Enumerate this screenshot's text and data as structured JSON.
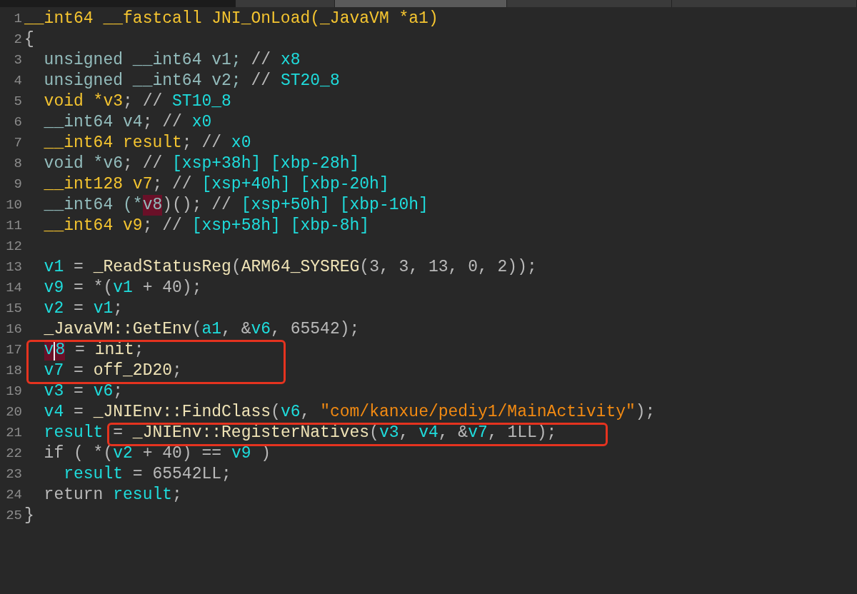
{
  "tabs": [
    {
      "selected": false
    },
    {
      "selected": true
    },
    {
      "selected": false
    },
    {
      "selected": false
    }
  ],
  "lines": [
    {
      "number": "1",
      "tokens": [
        {
          "t": "__int64 __fastcall JNI_OnLoad(_JavaVM *a1)",
          "kind": "decl"
        }
      ]
    },
    {
      "number": "2",
      "tokens": [
        {
          "t": "{",
          "kind": "op"
        }
      ]
    },
    {
      "number": "3",
      "tokens": [
        {
          "t": "  unsigned __int64 v1; ",
          "kind": "type"
        },
        {
          "t": "// ",
          "kind": "op"
        },
        {
          "t": "x8",
          "kind": "var"
        }
      ]
    },
    {
      "number": "4",
      "tokens": [
        {
          "t": "  unsigned __int64 v2; ",
          "kind": "type"
        },
        {
          "t": "// ",
          "kind": "op"
        },
        {
          "t": "ST20_8",
          "kind": "var"
        }
      ]
    },
    {
      "number": "5",
      "tokens": [
        {
          "t": "  void *v3",
          "kind": "decl"
        },
        {
          "t": "; // ",
          "kind": "op"
        },
        {
          "t": "ST10_8",
          "kind": "var"
        }
      ]
    },
    {
      "number": "6",
      "tokens": [
        {
          "t": "  __int64 v4",
          "kind": "type"
        },
        {
          "t": "; // ",
          "kind": "op"
        },
        {
          "t": "x0",
          "kind": "var"
        }
      ]
    },
    {
      "number": "7",
      "tokens": [
        {
          "t": "  __int64 result",
          "kind": "decl"
        },
        {
          "t": "; // ",
          "kind": "op"
        },
        {
          "t": "x0",
          "kind": "var"
        }
      ]
    },
    {
      "number": "8",
      "tokens": [
        {
          "t": "  void *v6",
          "kind": "type"
        },
        {
          "t": "; // ",
          "kind": "op"
        },
        {
          "t": "[xsp+38h] [xbp-28h]",
          "kind": "var"
        }
      ]
    },
    {
      "number": "9",
      "tokens": [
        {
          "t": "  __int128 v7",
          "kind": "decl"
        },
        {
          "t": "; // ",
          "kind": "op"
        },
        {
          "t": "[xsp+40h] [xbp-20h]",
          "kind": "var"
        }
      ]
    },
    {
      "number": "10",
      "tokens": [
        {
          "t": "  __int64 (*",
          "kind": "type"
        },
        {
          "t": "v8",
          "kind": "type",
          "highlighted": true
        },
        {
          "t": ")(); // ",
          "kind": "op"
        },
        {
          "t": "[xsp+50h] [xbp-10h]",
          "kind": "var"
        }
      ]
    },
    {
      "number": "11",
      "tokens": [
        {
          "t": "  __int64 v9",
          "kind": "decl"
        },
        {
          "t": "; // ",
          "kind": "op"
        },
        {
          "t": "[xsp+58h] [xbp-8h]",
          "kind": "var"
        }
      ]
    },
    {
      "number": "12"
    },
    {
      "number": "13",
      "tokens": [
        {
          "t": "  v1",
          "kind": "var"
        },
        {
          "t": " = ",
          "kind": "op"
        },
        {
          "t": "_ReadStatusReg",
          "kind": "func"
        },
        {
          "t": "(",
          "kind": "op"
        },
        {
          "t": "ARM64_SYSREG",
          "kind": "func"
        },
        {
          "t": "(3, 3, 13, 0, 2));",
          "kind": "op"
        }
      ]
    },
    {
      "number": "14",
      "tokens": [
        {
          "t": "  v9",
          "kind": "var"
        },
        {
          "t": " = *(",
          "kind": "op"
        },
        {
          "t": "v1",
          "kind": "var"
        },
        {
          "t": " + 40);",
          "kind": "op"
        }
      ]
    },
    {
      "number": "15",
      "tokens": [
        {
          "t": "  v2",
          "kind": "var"
        },
        {
          "t": " = ",
          "kind": "op"
        },
        {
          "t": "v1",
          "kind": "var"
        },
        {
          "t": ";",
          "kind": "op"
        }
      ]
    },
    {
      "number": "16",
      "tokens": [
        {
          "t": "  _JavaVM::GetEnv",
          "kind": "func"
        },
        {
          "t": "(",
          "kind": "op"
        },
        {
          "t": "a1",
          "kind": "var"
        },
        {
          "t": ", &",
          "kind": "op"
        },
        {
          "t": "v6",
          "kind": "var"
        },
        {
          "t": ", 65542);",
          "kind": "op"
        }
      ]
    },
    {
      "number": "17",
      "tokens": [
        {
          "kind": "box",
          "tokens": [
            {
              "t": "v",
              "kind": "var",
              "highlighted": true
            },
            {
              "t": "8",
              "kind": "var",
              "highlighted": true,
              "caret": true
            },
            {
              "t": " = ",
              "kind": "op"
            },
            {
              "t": "init",
              "kind": "func"
            },
            {
              "t": ";",
              "kind": "op"
            }
          ]
        }
      ]
    },
    {
      "number": "18",
      "tokens": [
        {
          "kind": "box",
          "tokens": [
            {
              "t": "v7",
              "kind": "var"
            },
            {
              "t": " = ",
              "kind": "op"
            },
            {
              "t": "off_2D20",
              "kind": "func"
            },
            {
              "t": ";",
              "kind": "op"
            }
          ]
        }
      ]
    },
    {
      "number": "19",
      "tokens": [
        {
          "t": "  v3",
          "kind": "var"
        },
        {
          "t": " = ",
          "kind": "op"
        },
        {
          "t": "v6",
          "kind": "var"
        },
        {
          "t": ";",
          "kind": "op"
        }
      ]
    },
    {
      "number": "20",
      "tokens": [
        {
          "t": "  v4",
          "kind": "var"
        },
        {
          "t": " = ",
          "kind": "op"
        },
        {
          "t": "_JNIEnv::FindClass",
          "kind": "func"
        },
        {
          "t": "(",
          "kind": "op"
        },
        {
          "t": "v6",
          "kind": "var"
        },
        {
          "t": ", ",
          "kind": "op"
        },
        {
          "t": "\"com/kanxue/pediy1/MainActivity\"",
          "kind": "str"
        },
        {
          "t": ");",
          "kind": "op"
        }
      ]
    },
    {
      "number": "21",
      "tokens": [
        {
          "t": "  result ",
          "kind": "var"
        },
        {
          "kind": "box",
          "tokens": [
            {
              "t": "= ",
              "kind": "op"
            },
            {
              "t": "_JNIEnv::RegisterNatives",
              "kind": "func"
            },
            {
              "t": "(",
              "kind": "op"
            },
            {
              "t": "v3",
              "kind": "var"
            },
            {
              "t": ", ",
              "kind": "op"
            },
            {
              "t": "v4",
              "kind": "var"
            },
            {
              "t": ", &",
              "kind": "op"
            },
            {
              "t": "v7",
              "kind": "var"
            },
            {
              "t": ", 1LL);",
              "kind": "op"
            }
          ]
        }
      ]
    },
    {
      "number": "22",
      "tokens": [
        {
          "t": "  if ( *(",
          "kind": "op"
        },
        {
          "t": "v2",
          "kind": "var"
        },
        {
          "t": " + 40) == ",
          "kind": "op"
        },
        {
          "t": "v9",
          "kind": "var"
        },
        {
          "t": " )",
          "kind": "op"
        }
      ]
    },
    {
      "number": "23",
      "tokens": [
        {
          "t": "    result",
          "kind": "var"
        },
        {
          "t": " = 65542LL;",
          "kind": "op"
        }
      ]
    },
    {
      "number": "24",
      "tokens": [
        {
          "t": "  return ",
          "kind": "op"
        },
        {
          "t": "result",
          "kind": "var"
        },
        {
          "t": ";",
          "kind": "op"
        }
      ]
    },
    {
      "number": "25",
      "tokens": [
        {
          "t": "}",
          "kind": "op"
        }
      ]
    }
  ]
}
